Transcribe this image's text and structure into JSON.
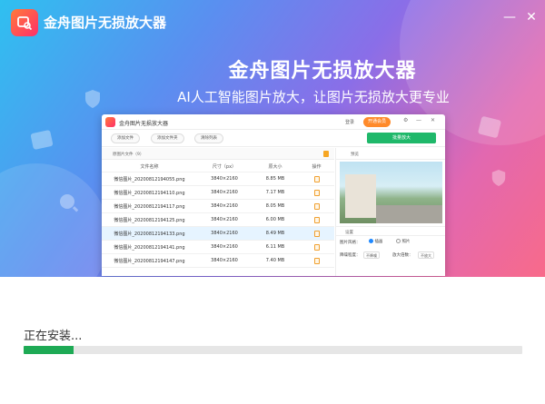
{
  "app": {
    "name": "金舟图片无损放大器",
    "logo_icon": "image-search-icon"
  },
  "window_controls": {
    "minimize_icon": "minimize-icon",
    "close_icon": "close-icon"
  },
  "hero": {
    "title": "金舟图片无损放大器",
    "subtitle": "AI人工智能图片放大，让图片无损放大更专业"
  },
  "preview_window": {
    "title": "金舟图片无损放大器",
    "login_label": "登录",
    "vip_label": "开通会员",
    "toolbar": {
      "add_file": "添加文件",
      "add_folder": "添加文件夹",
      "clear_list": "清除列表",
      "start": "批量放大"
    },
    "list_header": "原图片文件（9）",
    "columns": [
      "文件名称",
      "尺寸（px）",
      "原大小",
      "操作"
    ],
    "rows": [
      {
        "name": "微信图片_20200812194055.png",
        "size": "3840×2160",
        "filesize": "8.85 MB"
      },
      {
        "name": "微信图片_20200812194110.png",
        "size": "3840×2160",
        "filesize": "7.17 MB"
      },
      {
        "name": "微信图片_20200812194117.png",
        "size": "3840×2160",
        "filesize": "8.05 MB"
      },
      {
        "name": "微信图片_20200812194125.png",
        "size": "3840×2160",
        "filesize": "6.00 MB"
      },
      {
        "name": "微信图片_20200812194133.png",
        "size": "3840×2160",
        "filesize": "8.49 MB"
      },
      {
        "name": "微信图片_20200812194141.png",
        "size": "3840×2160",
        "filesize": "6.11 MB"
      },
      {
        "name": "微信图片_20200812194147.png",
        "size": "3840×2160",
        "filesize": "7.40 MB"
      }
    ],
    "selected_row": 4,
    "preview_label": "预览",
    "settings_label": "设置",
    "style_label": "图片风格：",
    "style_options": [
      "插画",
      "照片"
    ],
    "denoise_label": "降噪程度：",
    "denoise_value": "不降噪",
    "scale_label": "放大倍数：",
    "scale_value": "不放大"
  },
  "install": {
    "status": "正在安装...",
    "progress": 0.1
  },
  "colors": {
    "progress_fill": "#1eaa55",
    "primary_button": "#1fb86a",
    "vip": "#ff8a2a"
  }
}
